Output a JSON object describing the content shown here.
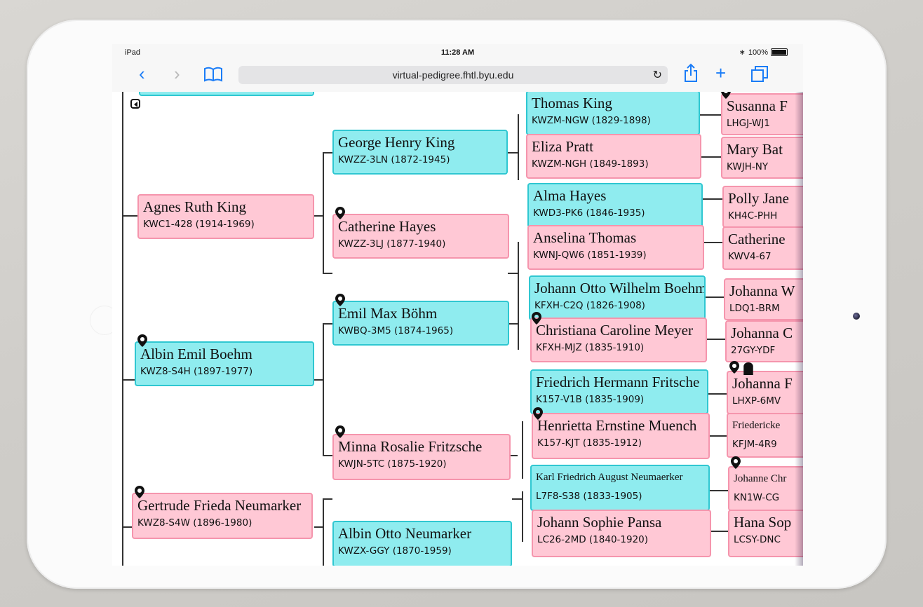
{
  "status_bar": {
    "carrier": "iPad",
    "time": "11:28 AM",
    "battery": "100%"
  },
  "browser": {
    "url": "virtual-pedigree.fhtl.byu.edu"
  },
  "icons": {
    "back": "chevron-left-icon",
    "forward": "chevron-right-icon",
    "bookmarks": "book-icon",
    "reload": "reload-icon",
    "share": "share-icon",
    "new_tab": "plus-icon",
    "tabs": "tabs-icon",
    "location": "map-pin-icon"
  },
  "colors": {
    "male": "#8fecef",
    "female": "#ffc8d5",
    "accent": "#1a7cf7"
  },
  "pedigree": {
    "gen1": [
      {
        "name": "Agnes Ruth King",
        "pid": "KWC1-428 (1914-1969)",
        "sex": "female"
      },
      {
        "name": "Albin Emil Boehm",
        "pid": "KWZ8-S4H (1897-1977)",
        "sex": "male"
      },
      {
        "name": "Gertrude Frieda Neumarker",
        "pid": "KWZ8-S4W (1896-1980)",
        "sex": "female"
      }
    ],
    "gen2": [
      {
        "name": "George Henry King",
        "pid": "KWZZ-3LN (1872-1945)",
        "sex": "male"
      },
      {
        "name": "Catherine Hayes",
        "pid": "KWZZ-3LJ (1877-1940)",
        "sex": "female"
      },
      {
        "name": "Emil Max Böhm",
        "pid": "KWBQ-3M5 (1874-1965)",
        "sex": "male"
      },
      {
        "name": "Minna Rosalie Fritzsche",
        "pid": "KWJN-5TC (1875-1920)",
        "sex": "female"
      },
      {
        "name": "Albin Otto Neumarker",
        "pid": "KWZX-GGY (1870-1959)",
        "sex": "male"
      }
    ],
    "gen3": [
      {
        "name": "Thomas King",
        "pid": "KWZM-NGW (1829-1898)",
        "sex": "male"
      },
      {
        "name": "Eliza Pratt",
        "pid": "KWZM-NGH (1849-1893)",
        "sex": "female"
      },
      {
        "name": "Alma Hayes",
        "pid": "KWD3-PK6 (1846-1935)",
        "sex": "male"
      },
      {
        "name": "Anselina Thomas",
        "pid": "KWNJ-QW6 (1851-1939)",
        "sex": "female"
      },
      {
        "name": "Johann Otto Wilhelm Boehm",
        "pid": "KFXH-C2Q (1826-1908)",
        "sex": "male"
      },
      {
        "name": "Christiana Caroline Meyer",
        "pid": "KFXH-MJZ (1835-1910)",
        "sex": "female"
      },
      {
        "name": "Friedrich Hermann Fritsche",
        "pid": "K157-V1B (1835-1909)",
        "sex": "male"
      },
      {
        "name": "Henrietta Ernstine Muench",
        "pid": "K157-KJT (1835-1912)",
        "sex": "female"
      },
      {
        "name": "Karl Friedrich August Neumaerker",
        "pid": "L7F8-S38 (1833-1905)",
        "sex": "male"
      },
      {
        "name": "Johann Sophie Pansa",
        "pid": "LC26-2MD (1840-1920)",
        "sex": "female"
      }
    ],
    "gen4": [
      {
        "name": "Susanna F",
        "pid": "LHGJ-WJ1",
        "sex": "female"
      },
      {
        "name": "Mary Bat",
        "pid": "KWJH-NY",
        "sex": "female"
      },
      {
        "name": "Polly Jane",
        "pid": "KH4C-PHH",
        "sex": "female"
      },
      {
        "name": "Catherine",
        "pid": "KWV4-67",
        "sex": "female"
      },
      {
        "name": "Johanna W",
        "pid": "LDQ1-BRM",
        "sex": "female"
      },
      {
        "name": "Johanna C",
        "pid": "27GY-YDF",
        "sex": "female"
      },
      {
        "name": "Johanna F",
        "pid": "LHXP-6MV",
        "sex": "female"
      },
      {
        "name": "Friedericke",
        "pid": "KFJM-4R9",
        "sex": "female"
      },
      {
        "name": "Johanne Chr",
        "pid": "KN1W-CG",
        "sex": "female"
      },
      {
        "name": "Hana Sop",
        "pid": "LCSY-DNC",
        "sex": "female"
      }
    ]
  }
}
